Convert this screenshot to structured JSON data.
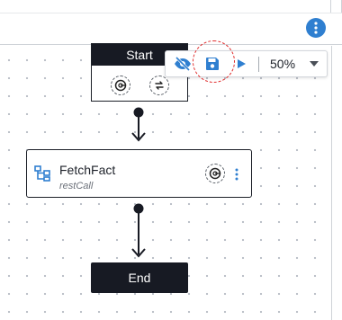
{
  "header": {
    "more_icon": "more-vertical-icon"
  },
  "flow": {
    "start": {
      "label": "Start",
      "icons": [
        "api-target-icon",
        "swap-arrows-icon"
      ]
    },
    "task": {
      "title": "FetchFact",
      "subtitle": "restCall",
      "type_icon": "hierarchy-icon",
      "action_icon": "api-target-icon",
      "menu_icon": "more-vertical-icon"
    },
    "end": {
      "label": "End"
    }
  },
  "toolbar": {
    "visibility_icon": "eye-off-icon",
    "save_icon": "save-icon",
    "run_icon": "play-icon",
    "zoom": "50%",
    "zoom_dropdown_icon": "caret-down-icon"
  },
  "colors": {
    "accent": "#2f7fd0",
    "node_dark": "#171a23",
    "annotation": "#e02b2b"
  }
}
